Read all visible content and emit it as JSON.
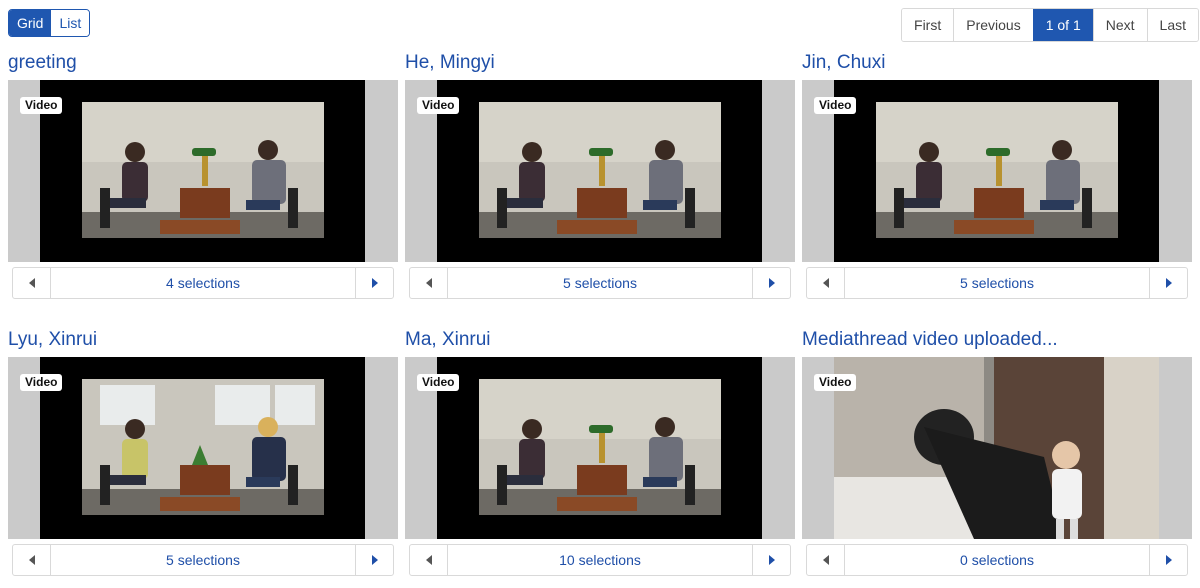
{
  "view_toggle": {
    "grid": "Grid",
    "list": "List",
    "active": "grid"
  },
  "pagination": {
    "first": "First",
    "previous": "Previous",
    "current": "1 of 1",
    "next": "Next",
    "last": "Last"
  },
  "items": [
    {
      "title": "greeting",
      "badge": "Video",
      "selections": "4 selections",
      "scene": "interview-plant-lamp"
    },
    {
      "title": "He, Mingyi",
      "badge": "Video",
      "selections": "5 selections",
      "scene": "interview-plant-lamp"
    },
    {
      "title": "Jin, Chuxi",
      "badge": "Video",
      "selections": "5 selections",
      "scene": "interview-plant-lamp"
    },
    {
      "title": "Lyu, Xinrui",
      "badge": "Video",
      "selections": "5 selections",
      "scene": "interview-windows"
    },
    {
      "title": "Ma, Xinrui",
      "badge": "Video",
      "selections": "10 selections",
      "scene": "interview-plant-lamp"
    },
    {
      "title": "Mediathread video uploaded...",
      "badge": "Video",
      "selections": "0 selections",
      "scene": "bathroom"
    }
  ],
  "colors": {
    "accent": "#1f57b0",
    "link": "#1f4fa8",
    "letterbox": "#000000",
    "pillarbox": "#cacaca"
  }
}
